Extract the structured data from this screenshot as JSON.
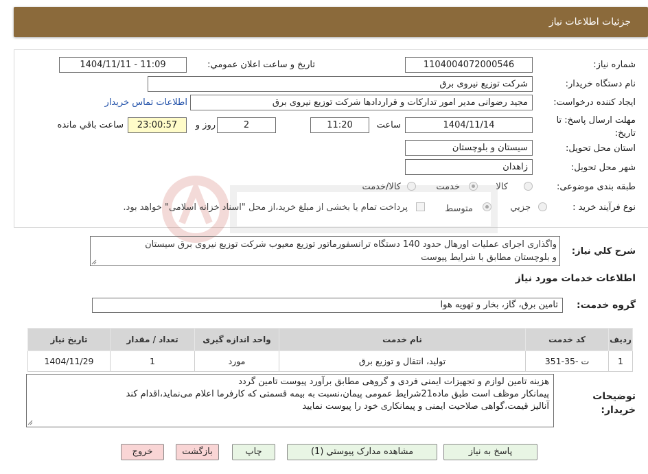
{
  "header": {
    "title": "جزئیات اطلاعات نیاز"
  },
  "fields": {
    "need_number_label": "شماره نیاز:",
    "need_number": "1104004072000546",
    "announce_label": "تاریخ و ساعت اعلان عمومي:",
    "announce_value": "1404/11/11 - 11:09",
    "buyer_org_label": "نام دستگاه خریدار:",
    "buyer_org": "شرکت توزیع نیروی برق",
    "requester_label": "ایجاد کننده درخواست:",
    "requester": "مجید  رضوانی مدیر امور تداركات و قراردادها شركت توزيع نيروی برق",
    "contact_link": "اطلاعات تماس خریدار",
    "deadline_label": "مهلت ارسال پاسخ: تا تاریخ:",
    "deadline_date": "1404/11/14",
    "time_label": "ساعت",
    "deadline_time": "11:20",
    "days_value": "2",
    "days_label": "روز و",
    "remaining_time": "23:00:57",
    "remaining_label": "ساعت باقي مانده",
    "province_label": "استان محل تحویل:",
    "province": "سیستان و بلوچستان",
    "city_label": "شهر محل تحویل:",
    "city": "زاهدان",
    "category_label": "طبقه بندی موضوعی:",
    "category_options": [
      "کالا",
      "خدمت",
      "کالا/خدمت"
    ],
    "category_selected": 1,
    "process_label": "نوع فرآیند خرید :",
    "process_options": [
      "جزیي",
      "متوسط"
    ],
    "process_selected": 1,
    "payment_note": "پرداخت تمام یا بخشی از مبلغ خرید،از محل \"اسناد خزانه اسلامی\" خواهد بود."
  },
  "description": {
    "label": "شرح کلي نیاز:",
    "text_line1": "واگذاری اجرای عملیات اورهال حدود 140 دستگاه ترانسفورماتور توزیع معیوب شرکت توزیع نیروی برق سیستان",
    "text_line2": "و بلوچستان مطابق با شرایط پیوست"
  },
  "services": {
    "section_title": "اطلاعات خدمات مورد نیاز",
    "group_label": "گروه خدمت:",
    "group_value": "تامین برق، گاز، بخار و تهویه هوا",
    "columns": [
      "ردیف",
      "کد خدمت",
      "نام خدمت",
      "واحد اندازه گیری",
      "تعداد / مقدار",
      "تاریخ نیاز"
    ],
    "rows": [
      [
        "1",
        "ت -35-351",
        "تولید، انتقال و توزیع برق",
        "مورد",
        "1",
        "1404/11/29"
      ]
    ]
  },
  "buyer_notes": {
    "label_line1": "توضیحات",
    "label_line2": "خریدار:",
    "line1": "هزینه تامین لوازم و تجهیزات ایمنی فردی و گروهی مطابق برآورد پیوست تامین گردد",
    "line2": "پیمانکار موظف است طبق ماده21شرایط عمومی پیمان،نسبت به بیمه قسمتی که کارفرما اعلام می‌نماید،اقدام کند",
    "line3": "آنالیز قیمت،گواهی صلاحیت ایمنی و پیمانکاری خود را پیوست نمایید"
  },
  "buttons": {
    "reply": "پاسخ به نیاز",
    "attachments": "مشاهده مدارک پیوستي (1)",
    "print": "چاپ",
    "back": "بازگشت",
    "exit": "خروج"
  },
  "colors": {
    "header_bg": "#8b6a3b",
    "button_green": "#e8f5e4",
    "button_pink": "#f9d5d5",
    "link": "#1f4fa8"
  }
}
